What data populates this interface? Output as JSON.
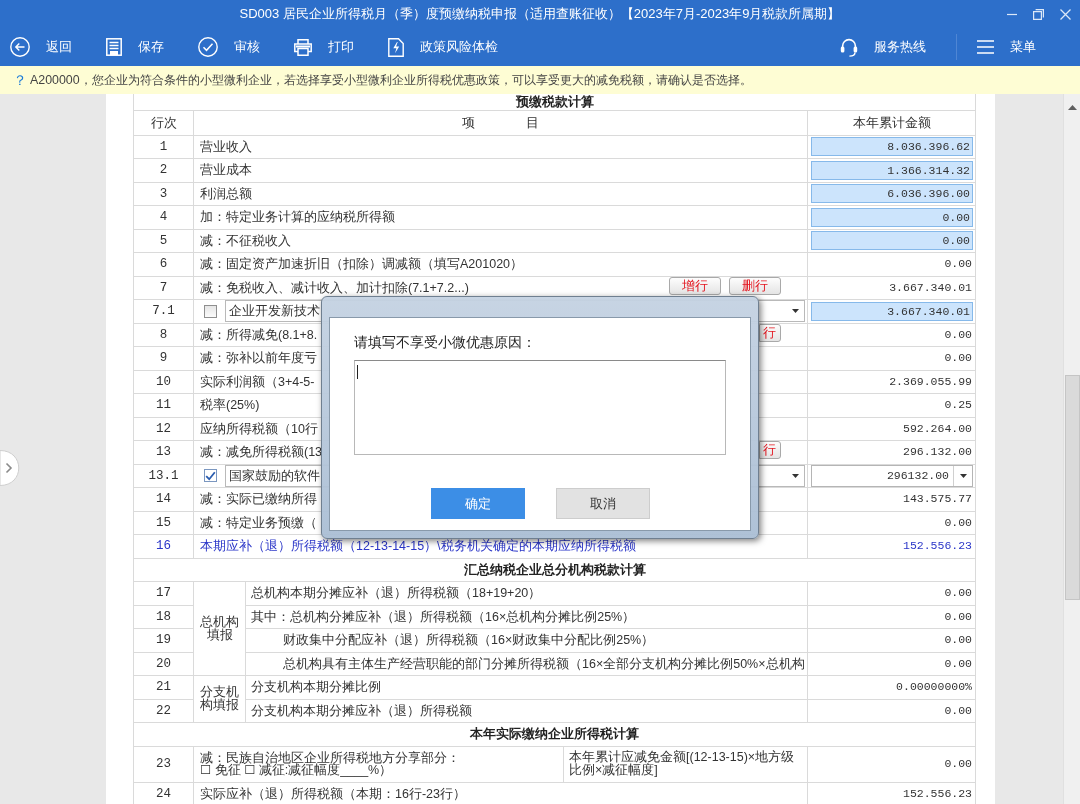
{
  "window": {
    "title": "SD003 居民企业所得税月（季）度预缴纳税申报（适用查账征收）【2023年7月-2023年9月税款所属期】"
  },
  "toolbar": {
    "left": [
      {
        "kind": "back",
        "label": "返回"
      },
      {
        "kind": "save",
        "label": "保存"
      },
      {
        "kind": "audit",
        "label": "审核"
      },
      {
        "kind": "print",
        "label": "打印"
      },
      {
        "kind": "policy",
        "label": "政策风险体检"
      }
    ],
    "right": [
      {
        "kind": "hotline",
        "label": "服务热线"
      },
      {
        "kind": "menu",
        "label": "菜单"
      }
    ]
  },
  "notice": {
    "mark": "？",
    "text": "A200000，您企业为符合条件的小型微利企业，若选择享受小型微利企业所得税优惠政策，可以享受更大的减免税额，请确认是否选择。"
  },
  "form": {
    "title": "预缴税款计算",
    "columns": [
      "行次",
      "项 目",
      "本年累计金额"
    ],
    "rows": [
      {
        "kind": "item",
        "no": "1",
        "item": "营业收入",
        "value": "8.036.396.62",
        "editable": true,
        "dropdown": false
      },
      {
        "kind": "item",
        "no": "2",
        "item": "营业成本",
        "value": "1.366.314.32",
        "editable": true,
        "dropdown": false
      },
      {
        "kind": "item",
        "no": "3",
        "item": "利润总额",
        "value": "6.036.396.00",
        "editable": true,
        "dropdown": false
      },
      {
        "kind": "item",
        "no": "4",
        "item": "加：特定业务计算的应纳税所得额",
        "value": "0.00",
        "editable": true,
        "dropdown": false
      },
      {
        "kind": "item",
        "no": "5",
        "item": "减：不征税收入",
        "value": "0.00",
        "editable": true,
        "dropdown": false
      },
      {
        "kind": "item",
        "no": "6",
        "item": "减：固定资产加速折旧（扣除）调减额（填写A201020）",
        "value": "0.00",
        "editable": false
      },
      {
        "kind": "item",
        "no": "7",
        "item": "减：免税收入、减计收入、加计扣除(7.1+7.2...)",
        "value": "3.667.340.01",
        "editable": false,
        "buttons": [
          "增行",
          "删行"
        ]
      },
      {
        "kind": "option",
        "no": "7.1",
        "checked": false,
        "option": "企业开发新技术",
        "value": "3.667.340.01",
        "editable": true,
        "dropdown": false
      },
      {
        "kind": "item",
        "no": "8",
        "item": "减：所得减免(8.1+8.",
        "value": "0.00",
        "editable": false,
        "buttons": [
          "行"
        ]
      },
      {
        "kind": "item",
        "no": "9",
        "item": "减：弥补以前年度亏",
        "value": "0.00",
        "editable": false
      },
      {
        "kind": "item",
        "no": "10",
        "item": "实际利润额（3+4-5-",
        "value": "2.369.055.99",
        "editable": false
      },
      {
        "kind": "item",
        "no": "11",
        "item": "税率(25%)",
        "value": "0.25",
        "editable": false
      },
      {
        "kind": "item",
        "no": "12",
        "item": "应纳所得税额（10行",
        "value": "592.264.00",
        "editable": false
      },
      {
        "kind": "item",
        "no": "13",
        "item": "减：减免所得税额(13",
        "value": "296.132.00",
        "editable": false,
        "buttons": [
          "行"
        ]
      },
      {
        "kind": "option",
        "no": "13.1",
        "checked": true,
        "option": "国家鼓励的软件",
        "value": "296132.00",
        "editable": true,
        "dropdown": true
      },
      {
        "kind": "item",
        "no": "14",
        "item": "减：实际已缴纳所得",
        "value": "143.575.77",
        "editable": false
      },
      {
        "kind": "item",
        "no": "15",
        "item": "减：特定业务预缴（",
        "value": "0.00",
        "editable": false
      },
      {
        "kind": "total",
        "no": "16",
        "item": "本期应补（退）所得税额（12-13-14-15）\\税务机关确定的本期应纳所得税额",
        "value": "152.556.23",
        "editable": false
      },
      {
        "kind": "section",
        "title": "汇总纳税企业总分机构税款计算"
      },
      {
        "kind": "group",
        "label": "总机构填报",
        "rows": [
          {
            "no": "17",
            "item": "总机构本期分摊应补（退）所得税额（18+19+20）",
            "value": "0.00",
            "editable": false
          },
          {
            "no": "18",
            "item": "其中：总机构分摊应补（退）所得税额（16×总机构分摊比例25%）",
            "value": "0.00",
            "editable": false,
            "children": [
              {
                "no": "19",
                "item": "财政集中分配应补（退）所得税额（16×财政集中分配比例25%）",
                "value": "0.00",
                "editable": false
              },
              {
                "no": "20",
                "item": "总机构具有主体生产经营职能的部门分摊所得税额（16×全部分支机构分摊比例50%×总机构",
                "value": "0.00",
                "editable": false
              }
            ]
          }
        ]
      },
      {
        "kind": "group",
        "label": "分支机构填报",
        "rows": [
          {
            "no": "21",
            "item": "分支机构本期分摊比例",
            "value": "0.00000000%",
            "editable": false
          },
          {
            "no": "22",
            "item": "分支机构本期分摊应补（退）所得税额",
            "value": "0.00",
            "editable": false
          }
        ]
      },
      {
        "kind": "section",
        "title": "本年实际缴纳企业所得税计算"
      },
      {
        "kind": "split",
        "no": "23",
        "item": [
          "减：民族自治地区企业所得税地方分享部分：",
          "☐ 免征 ☐ 减征:减征幅度____%）"
        ],
        "note": "本年累计应减免金额[(12-13-15)×地方级比例×减征幅度]",
        "value": "0.00",
        "editable": false
      },
      {
        "kind": "item",
        "no": "24",
        "item": "实际应补（退）所得税额（本期：16行-23行）",
        "value": "152.556.23",
        "editable": false
      }
    ]
  },
  "dialog": {
    "prompt": "请填写不享受小微优惠原因：",
    "buttons": [
      {
        "label": "确定",
        "primary": true
      },
      {
        "label": "取消",
        "primary": false
      }
    ]
  }
}
